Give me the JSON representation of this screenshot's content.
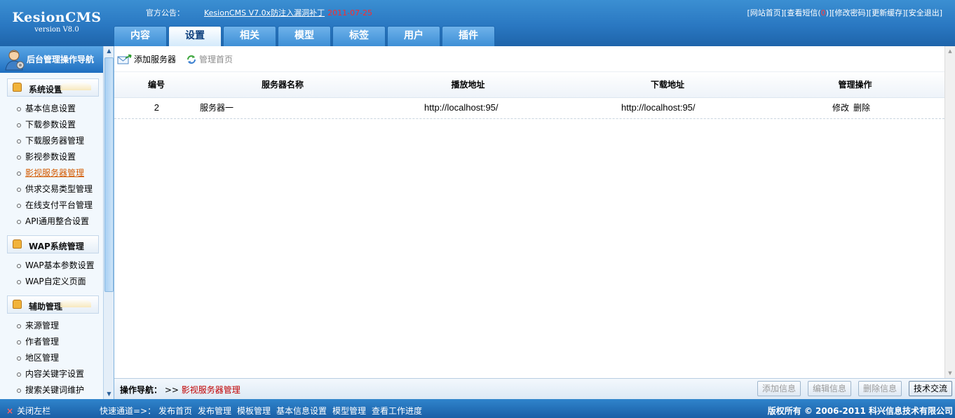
{
  "logo": {
    "name": "KesionCMS",
    "version": "version V8.0"
  },
  "notice": {
    "label": "官方公告：",
    "link": "KesionCMS V7.0x防注入漏洞补丁",
    "date": "2011-07-25"
  },
  "top_links": {
    "site_home": "[网站首页]",
    "messages_prefix": "[查看短信(",
    "messages_count": "0",
    "messages_suffix": ")]",
    "change_password": "[修改密码]",
    "update_cache": "[更新缓存]",
    "logout": "[安全退出]"
  },
  "tabs": [
    {
      "label": "内容"
    },
    {
      "label": "设置"
    },
    {
      "label": "相关"
    },
    {
      "label": "模型"
    },
    {
      "label": "标签"
    },
    {
      "label": "用户"
    },
    {
      "label": "插件"
    }
  ],
  "sidebar": {
    "title": "后台管理操作导航",
    "groups": [
      {
        "title": "系统设置",
        "items": [
          "基本信息设置",
          "下载参数设置",
          "下载服务器管理",
          "影视参数设置",
          "影视服务器管理",
          "供求交易类型管理",
          "在线支付平台管理",
          "API通用整合设置"
        ]
      },
      {
        "title": "WAP系统管理",
        "items": [
          "WAP基本参数设置",
          "WAP自定义页面"
        ]
      },
      {
        "title": "辅助管理",
        "items": [
          "来源管理",
          "作者管理",
          "地区管理",
          "内容关键字设置",
          "搜索关键词维护"
        ]
      }
    ]
  },
  "toolbar": {
    "add_server": "添加服务器",
    "manage_home": "管理首页"
  },
  "table": {
    "headers": [
      "编号",
      "服务器名称",
      "播放地址",
      "下载地址",
      "管理操作"
    ],
    "rows": [
      {
        "id": "2",
        "name": "服务器一",
        "play_url": "http://localhost:95/",
        "download_url": "http://localhost:95/",
        "edit": "修改",
        "delete": "删除"
      }
    ]
  },
  "op_bar": {
    "label": "操作导航：",
    "sep": ">>",
    "current": "影视服务器管理",
    "buttons": {
      "add": "添加信息",
      "edit": "编辑信息",
      "delete": "删除信息",
      "tech": "技术交流"
    }
  },
  "footer": {
    "close_left": "关闭左栏",
    "quick_label": "快速通道=>：",
    "quick_links": [
      "发布首页",
      "发布管理",
      "模板管理",
      "基本信息设置",
      "模型管理",
      "查看工作进度"
    ],
    "copyright": "版权所有 © 2006-2011 科兴信息技术有限公司"
  }
}
